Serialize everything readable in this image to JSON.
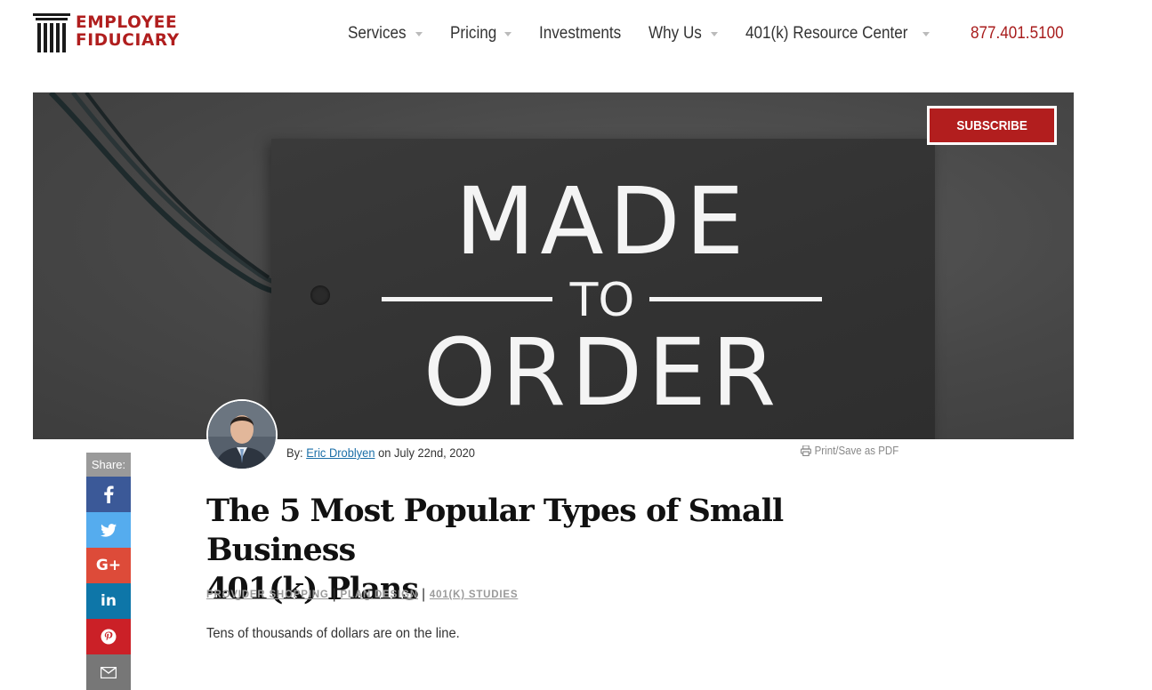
{
  "brand": {
    "line1": "EMPLOYEE",
    "line2": "FIDUCIARY",
    "color": "#b01e1e"
  },
  "nav": {
    "items": [
      {
        "label": "Services",
        "has_dropdown": true
      },
      {
        "label": "Pricing",
        "has_dropdown": true
      },
      {
        "label": "Investments",
        "has_dropdown": false
      },
      {
        "label": "Why Us",
        "has_dropdown": true
      },
      {
        "label": "401(k) Resource Center",
        "has_dropdown": true
      }
    ],
    "phone": "877.401.5100"
  },
  "hero": {
    "line1": "MADE",
    "line2": "TO",
    "line3": "ORDER",
    "subscribe_label": "SUBSCRIBE"
  },
  "author": {
    "prefix": "By:",
    "name": "Eric Droblyen",
    "date_text": "on July 22nd, 2020"
  },
  "print_label": "Print/Save as PDF",
  "share": {
    "label": "Share:",
    "buttons": [
      {
        "network": "facebook",
        "icon": "facebook-icon",
        "color": "#3b5998"
      },
      {
        "network": "twitter",
        "icon": "twitter-icon",
        "color": "#55acee"
      },
      {
        "network": "google-plus",
        "icon": "google-plus-icon",
        "color": "#dd4b39"
      },
      {
        "network": "linkedin",
        "icon": "linkedin-icon",
        "color": "#0e76a8"
      },
      {
        "network": "pinterest",
        "icon": "pinterest-icon",
        "color": "#cb2027"
      },
      {
        "network": "email",
        "icon": "email-icon",
        "color": "#777777"
      }
    ]
  },
  "article": {
    "title_line1": "The 5 Most Popular Types of Small Business",
    "title_line2": "401(k) Plans",
    "categories": [
      "PROVIDER SHOPPING",
      "PLAN DESIGN",
      "401(K) STUDIES"
    ],
    "lede": "Tens of thousands of dollars are on the line."
  },
  "colors": {
    "accent": "#b21e1e",
    "link": "#1b6fa8"
  }
}
